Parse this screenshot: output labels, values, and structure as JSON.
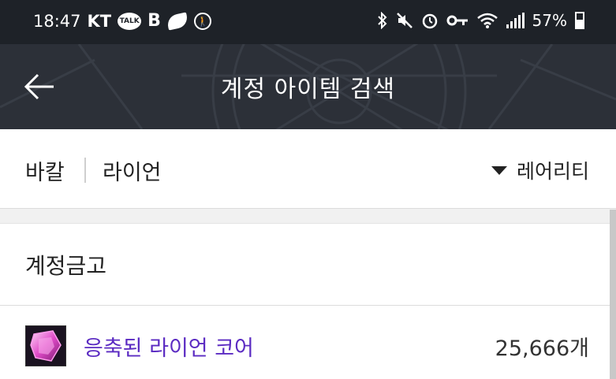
{
  "status_bar": {
    "time": "18:47",
    "carrier": "KT",
    "kakao_label": "TALK",
    "b_icon": "B",
    "battery": "57%"
  },
  "header": {
    "title": "계정 아이템 검색",
    "back_icon": "back-arrow-icon"
  },
  "filter": {
    "server": "바칼",
    "character": "라이언",
    "sort_label": "레어리티"
  },
  "section": {
    "title": "계정금고"
  },
  "items": [
    {
      "name": "응축된 라이언 코어",
      "count": "25,666개",
      "name_color": "#5b2bc2"
    }
  ]
}
